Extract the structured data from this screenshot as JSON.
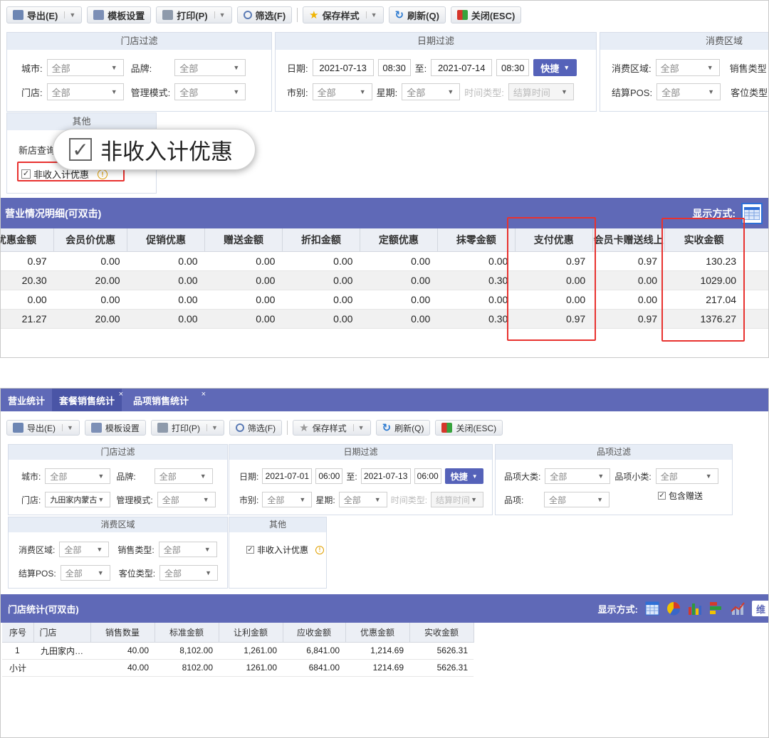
{
  "top": {
    "toolbar": {
      "export": "导出(E)",
      "template": "模板设置",
      "print": "打印(P)",
      "filter": "筛选(F)",
      "save_style": "保存样式",
      "refresh": "刷新(Q)",
      "close": "关闭(ESC)"
    },
    "store_filter": {
      "title": "门店过滤",
      "city_label": "城市:",
      "city_value": "全部",
      "brand_label": "品牌:",
      "brand_value": "全部",
      "store_label": "门店:",
      "store_value": "全部",
      "mode_label": "管理模式:",
      "mode_value": "全部"
    },
    "date_filter": {
      "title": "日期过滤",
      "date_label": "日期:",
      "date_from": "2021-07-13",
      "time_from": "08:30",
      "to_label": "至:",
      "date_to": "2021-07-14",
      "time_to": "08:30",
      "fast": "快捷",
      "market_label": "市别:",
      "market_value": "全部",
      "week_label": "星期:",
      "week_value": "全部",
      "time_type_label": "时间类型:",
      "time_type_value": "结算时间"
    },
    "consume_filter": {
      "title": "消费区域",
      "area_label": "消费区域:",
      "area_value": "全部",
      "sale_type_label": "销售类型",
      "pos_label": "结算POS:",
      "pos_value": "全部",
      "seat_label": "客位类型"
    },
    "other": {
      "title": "其他",
      "new_store_label": "新店查询",
      "non_income_label": "非收入计优惠"
    },
    "zoom_label": "非收入计优惠",
    "grid_title": "营业情况明细(可双击)",
    "display_mode": "显示方式:",
    "table": {
      "columns": [
        "优惠金额",
        "会员价优惠",
        "促销优惠",
        "赠送金额",
        "折扣金额",
        "定额优惠",
        "抹零金额",
        "支付优惠",
        "会员卡赠送线上",
        "实收金额"
      ],
      "rows": [
        [
          "0.97",
          "0.00",
          "0.00",
          "0.00",
          "0.00",
          "0.00",
          "0.00",
          "0.97",
          "0.97",
          "130.23"
        ],
        [
          "20.30",
          "20.00",
          "0.00",
          "0.00",
          "0.00",
          "0.00",
          "0.30",
          "0.00",
          "0.00",
          "1029.00"
        ],
        [
          "0.00",
          "0.00",
          "0.00",
          "0.00",
          "0.00",
          "0.00",
          "0.00",
          "0.00",
          "0.00",
          "217.04"
        ],
        [
          "21.27",
          "20.00",
          "0.00",
          "0.00",
          "0.00",
          "0.00",
          "0.30",
          "0.97",
          "0.97",
          "1376.27"
        ]
      ]
    }
  },
  "bottom": {
    "tabs": [
      "营业统计",
      "套餐销售统计",
      "品项销售统计"
    ],
    "toolbar": {
      "export": "导出(E)",
      "template": "模板设置",
      "print": "打印(P)",
      "filter": "筛选(F)",
      "save_style": "保存样式",
      "refresh": "刷新(Q)",
      "close": "关闭(ESC)"
    },
    "store_filter": {
      "title": "门店过滤",
      "city_label": "城市:",
      "city_value": "全部",
      "brand_label": "品牌:",
      "brand_value": "全部",
      "store_label": "门店:",
      "store_value": "九田家内蒙古",
      "mode_label": "管理模式:",
      "mode_value": "全部"
    },
    "date_filter": {
      "title": "日期过滤",
      "date_label": "日期:",
      "date_from": "2021-07-01",
      "time_from": "06:00",
      "to_label": "至:",
      "date_to": "2021-07-13",
      "time_to": "06:00",
      "fast": "快捷",
      "market_label": "市别:",
      "market_value": "全部",
      "week_label": "星期:",
      "week_value": "全部",
      "time_type_label": "时间类型:",
      "time_type_value": "结算时间"
    },
    "item_filter": {
      "title": "品项过滤",
      "big_label": "品项大类:",
      "big_value": "全部",
      "small_label": "品项小类:",
      "small_value": "全部",
      "item_label": "品项:",
      "item_value": "全部",
      "include_gift": "包含赠送"
    },
    "consume_filter": {
      "title": "消费区域",
      "area_label": "消费区域:",
      "area_value": "全部",
      "sale_type_label": "销售类型:",
      "sale_type_value": "全部",
      "pos_label": "结算POS:",
      "pos_value": "全部",
      "seat_label": "客位类型:",
      "seat_value": "全部"
    },
    "other": {
      "title": "其他",
      "non_income_label": "非收入计优惠"
    },
    "grid_title": "门店统计(可双击)",
    "display_mode": "显示方式:",
    "dim_btn": "维",
    "table": {
      "columns": [
        "序号",
        "门店",
        "销售数量",
        "标准金额",
        "让利金额",
        "应收金额",
        "优惠金额",
        "实收金额"
      ],
      "rows": [
        [
          "1",
          "九田家内…",
          "40.00",
          "8,102.00",
          "1,261.00",
          "6,841.00",
          "1,214.69",
          "5626.31"
        ],
        [
          "小计",
          "",
          "40.00",
          "8102.00",
          "1261.00",
          "6841.00",
          "1214.69",
          "5626.31"
        ]
      ]
    }
  }
}
